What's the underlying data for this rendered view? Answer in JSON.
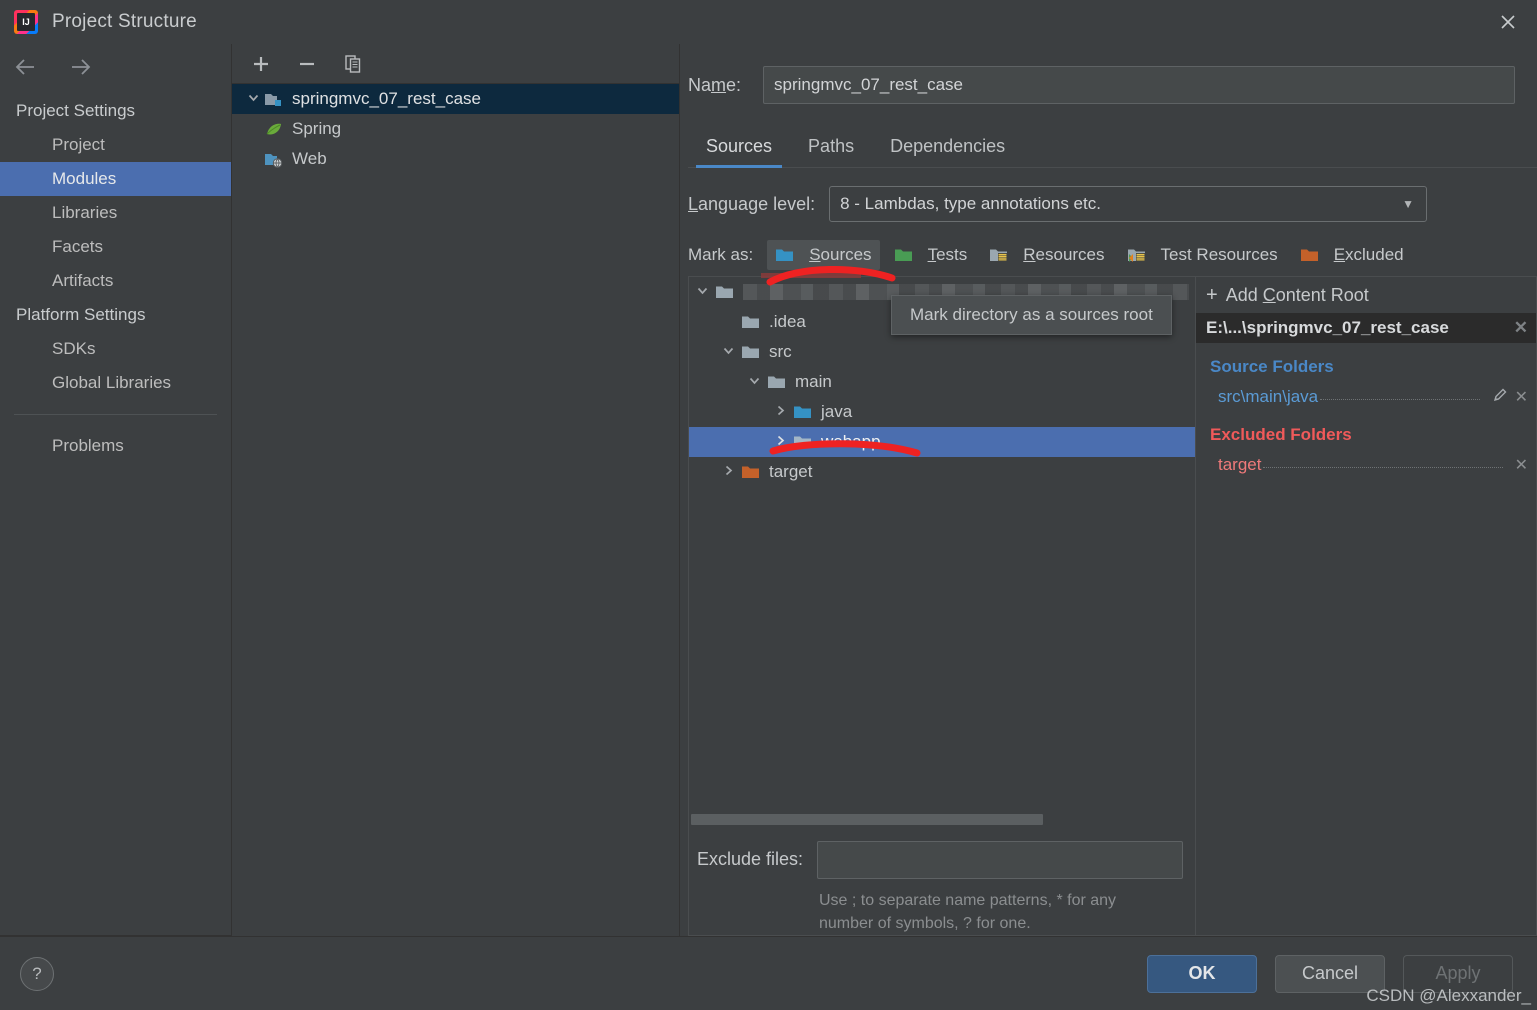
{
  "window": {
    "title": "Project Structure",
    "logo_icon": "intellij-idea-logo",
    "close_icon": "close-icon"
  },
  "sidebar": {
    "back_icon": "arrow-left-icon",
    "forward_icon": "arrow-right-icon",
    "groups": [
      {
        "label": "Project Settings",
        "items": [
          {
            "label": "Project",
            "selected": false
          },
          {
            "label": "Modules",
            "selected": true
          },
          {
            "label": "Libraries",
            "selected": false
          },
          {
            "label": "Facets",
            "selected": false
          },
          {
            "label": "Artifacts",
            "selected": false
          }
        ]
      },
      {
        "label": "Platform Settings",
        "items": [
          {
            "label": "SDKs",
            "selected": false
          },
          {
            "label": "Global Libraries",
            "selected": false
          }
        ]
      }
    ],
    "problems": {
      "label": "Problems"
    }
  },
  "modules_panel": {
    "toolbar": {
      "add_label": "+",
      "remove_label": "−",
      "copy_icon": "copy-icon"
    },
    "tree": [
      {
        "label": "springmvc_07_rest_case",
        "icon": "module-folder-icon",
        "selected": true,
        "expanded": true,
        "depth": 0
      },
      {
        "label": "Spring",
        "icon": "spring-leaf-icon",
        "selected": false,
        "depth": 1
      },
      {
        "label": "Web",
        "icon": "web-facet-icon",
        "selected": false,
        "depth": 1
      }
    ]
  },
  "main": {
    "name_field": {
      "label": "Name:",
      "label_mnemonic": "m",
      "value": "springmvc_07_rest_case",
      "placeholder": ""
    },
    "tabs": [
      {
        "label": "Sources",
        "active": true
      },
      {
        "label": "Paths",
        "active": false
      },
      {
        "label": "Dependencies",
        "active": false
      }
    ],
    "language_level": {
      "label": "Language level:",
      "value": "8 - Lambdas, type annotations etc.",
      "arrow_icon": "chevron-down-icon"
    },
    "mark_as": {
      "label": "Mark as:",
      "options": [
        {
          "label": "Sources",
          "mnemonic": "S",
          "icon": "folder-sources-icon",
          "color": "#3592c4",
          "hover": true
        },
        {
          "label": "Tests",
          "mnemonic": "T",
          "icon": "folder-tests-icon",
          "color": "#499c54",
          "hover": false
        },
        {
          "label": "Resources",
          "mnemonic": "R",
          "icon": "folder-resources-icon",
          "color": "#9aa7b0",
          "hover": false
        },
        {
          "label": "Test Resources",
          "mnemonic": "",
          "icon": "folder-test-resources-icon",
          "color": "#cc7832",
          "hover": false
        },
        {
          "label": "Excluded",
          "mnemonic": "E",
          "icon": "folder-excluded-icon",
          "color": "#cc7832",
          "hover": false
        }
      ]
    },
    "directory_tree": {
      "root_row_censored": true,
      "rows": [
        {
          "label": ".idea",
          "depth": 1,
          "chevron": "",
          "icon": "folder-plain-icon",
          "color": "#9aa7b0",
          "selected": false
        },
        {
          "label": "src",
          "depth": 1,
          "chevron": "expanded",
          "icon": "folder-plain-icon",
          "color": "#9aa7b0",
          "selected": false
        },
        {
          "label": "main",
          "depth": 2,
          "chevron": "expanded",
          "icon": "folder-plain-icon",
          "color": "#9aa7b0",
          "selected": false
        },
        {
          "label": "java",
          "depth": 3,
          "chevron": "collapsed",
          "icon": "folder-sources-icon",
          "color": "#3592c4",
          "selected": false
        },
        {
          "label": "webapp",
          "depth": 3,
          "chevron": "collapsed",
          "icon": "folder-plain-icon",
          "color": "#a3b6c6",
          "selected": true
        },
        {
          "label": "target",
          "depth": 1,
          "chevron": "collapsed",
          "icon": "folder-excluded-icon",
          "color": "#cc7832",
          "selected": false
        }
      ]
    },
    "tooltip": {
      "text": "Mark directory as a sources root"
    },
    "exclude_files": {
      "label": "Exclude files:",
      "value": "",
      "placeholder": "",
      "hint_line1": "Use ; to separate name patterns, * for any",
      "hint_line2": "number of symbols, ? for one."
    }
  },
  "roots_pane": {
    "add_content_root": {
      "label": "Add Content Root",
      "mnemonic": "C",
      "icon": "plus-icon"
    },
    "content_root": {
      "label": "E:\\...\\springmvc_07_rest_case",
      "remove_icon": "close-icon"
    },
    "source_folders": {
      "title": "Source Folders",
      "color": "#4a88c7",
      "items": [
        {
          "label": "src\\main\\java",
          "edit_icon": "pencil-icon",
          "remove_icon": "close-icon"
        }
      ]
    },
    "excluded_folders": {
      "title": "Excluded Folders",
      "color": "#f05a5a",
      "items": [
        {
          "label": "target",
          "remove_icon": "close-icon"
        }
      ]
    }
  },
  "footer": {
    "help_label": "?",
    "ok_label": "OK",
    "cancel_label": "Cancel",
    "apply_label": "Apply"
  },
  "watermark": {
    "text": "CSDN @Alexxander_"
  },
  "colors": {
    "accent_blue": "#4b6eaf",
    "tab_underline": "#4a88c7",
    "window_bg": "#3c3f41",
    "selection_dark": "#0d293e",
    "annotation_red": "#ee2222"
  }
}
